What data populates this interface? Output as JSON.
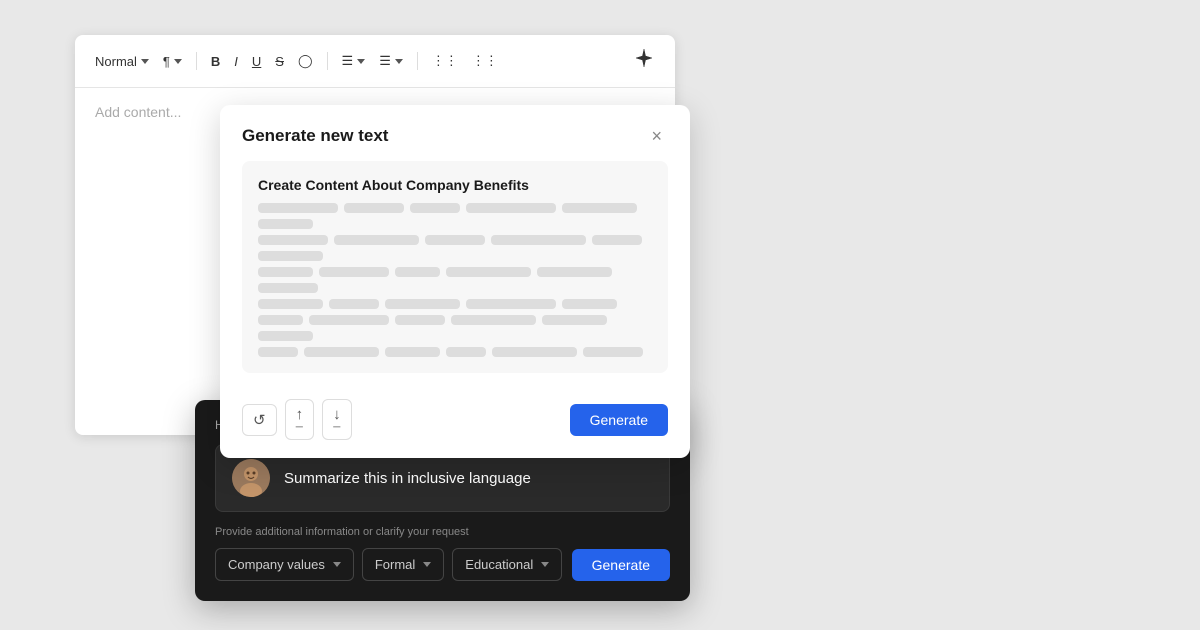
{
  "editor": {
    "style_label": "Normal",
    "placeholder": "Add content...",
    "toolbar": {
      "bold": "B",
      "italic": "I",
      "underline": "U",
      "strikethrough": "S",
      "align_label": "≡",
      "indent_label": "≡",
      "bullet_label": "≡",
      "ordered_label": "≡"
    }
  },
  "generate_modal": {
    "title": "Generate new text",
    "close_label": "×",
    "preview_title": "Create Content About Company Benefits",
    "actions": {
      "refresh_label": "↺",
      "shorten_label": "↑",
      "lengthen_label": "↓",
      "generate_label": "Generate"
    }
  },
  "improve_panel": {
    "question_label": "How would you like to improve this text?",
    "suggestion_text": "Summarize this in inclusive language",
    "info_label": "Provide additional information or clarify your request",
    "dropdowns": {
      "topic_label": "Company values",
      "tone_label": "Formal",
      "style_label": "Educational"
    },
    "generate_label": "Generate"
  }
}
